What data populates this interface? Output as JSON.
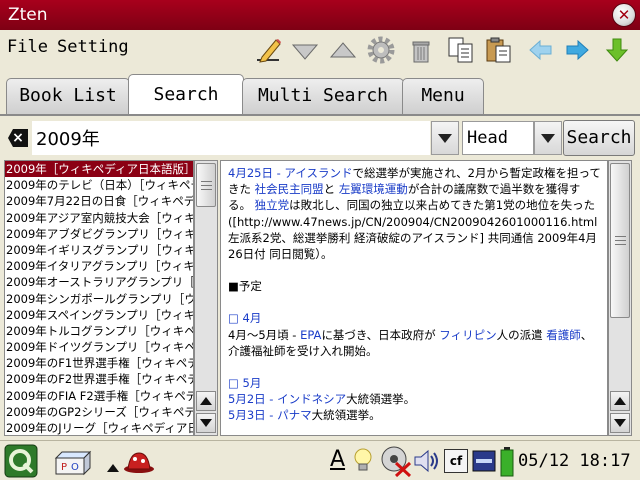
{
  "window": {
    "title": "Zten",
    "close_glyph": "✕"
  },
  "menubar": {
    "menus": [
      "File",
      "Setting"
    ],
    "toolbar_icons": [
      "edit-pencil-icon",
      "scroll-down-icon",
      "scroll-up-icon",
      "settings-gear-icon",
      "trash-icon",
      "copy-icon",
      "paste-icon",
      "back-arrow-icon",
      "forward-arrow-icon",
      "download-arrow-icon"
    ]
  },
  "tabs": [
    {
      "label": "Book List"
    },
    {
      "label": "Search",
      "active": true
    },
    {
      "label": "Multi Search"
    },
    {
      "label": "Menu"
    }
  ],
  "search": {
    "query": "2009年",
    "mode": "Head",
    "button_label": "Search"
  },
  "results": [
    "2009年［ウィキペディア日本語版］",
    "2009年のテレビ（日本）［ウィキペディア日本語版］",
    "2009年7月22日の日食［ウィキペディア日本語版］",
    "2009年アジア室内競技大会［ウィキペディア日本語版］",
    "2009年アブダビグランプリ［ウィキペディア日本語版］",
    "2009年イギリスグランプリ［ウィキペディア日本語版］",
    "2009年イタリアグランプリ［ウィキペディア日本語版］",
    "2009年オーストラリアグランプリ［ウィキペディア日本語版］",
    "2009年シンガポールグランプリ［ウィキペディア日本語版］",
    "2009年スペイングランプリ［ウィキペディア日本語版］",
    "2009年トルコグランプリ［ウィキペディア日本語版］",
    "2009年ドイツグランプリ［ウィキペディア日本語版］",
    "2009年のF1世界選手権［ウィキペディア日本語版］",
    "2009年のF2世界選手権［ウィキペディア日本語版］",
    "2009年のFIA F2選手権［ウィキペディア日本語版］",
    "2009年のGP2シリーズ［ウィキペディア日本語版］",
    "2009年のJリーグ［ウィキペディア日本語版］"
  ],
  "article": {
    "p1_date": "4月25日",
    "p1_dash": " - ",
    "p1_link1": "アイスランド",
    "p1_text1": "で総選挙が実施され、2月から暫定政権を担ってきた",
    "p1_link2": "社会民主同盟",
    "p1_text2": "と",
    "p1_link3": "左翼環境運動",
    "p1_text3": "が合計の議席数で過半数を獲得する。",
    "p1_link4": "独立党",
    "p1_text4": "は敗北し、同国の独立以来占めてきた第1党の地位を失った",
    "p1_citation": "([http://www.47news.jp/CN/200904/CN2009042601000116.html 左派系2党、総選挙勝利 経済破綻のアイスランド] 共同通信 2009年4月26日付 同日閲覧）。",
    "section_heading": "■予定",
    "month_april": "□ 4月",
    "april_text1": "4月～5月頃 - ",
    "april_link1": "EPA",
    "april_text2": "に基づき、日本政府が",
    "april_link2": "フィリピン",
    "april_text3": "人の派遣",
    "april_link3": "看護師",
    "april_text4": "、介護福祉師を受け入れ開始。",
    "month_may": "□ 5月",
    "may2_date": "5月2日",
    "may2_dash": " - ",
    "may2_link": "インドネシア",
    "may2_text": "大統領選挙。",
    "may3_date": "5月3日",
    "may3_dash": " - ",
    "may3_link": "パナマ",
    "may3_text": "大統領選挙。"
  },
  "taskbar": {
    "icons": [
      "launcher-q-icon",
      "keyboard-pobox-icon",
      "up-triangle-icon",
      "app-hat-icon",
      "input-method-a-icon",
      "light-bulb-icon",
      "network-disconnected-icon",
      "volume-icon",
      "cf-card-icon",
      "sd-card-icon",
      "battery-icon"
    ],
    "input_label": "A",
    "cf_label": "cf",
    "clock": "05/12 18:17"
  },
  "colors": {
    "title_bar": "#8b0014",
    "selection": "#8b0014",
    "link": "#1a3cc8",
    "forward_arrow": "#3fa9e0",
    "download_arrow": "#6cc02a"
  }
}
